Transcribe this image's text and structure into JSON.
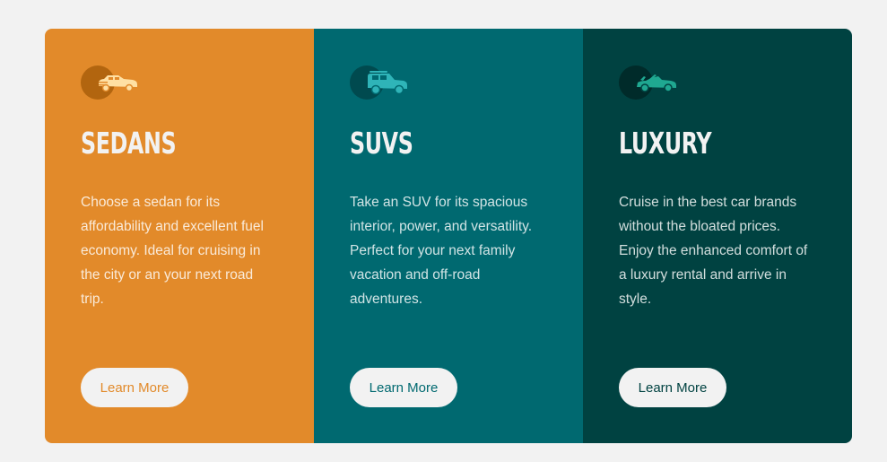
{
  "colors": {
    "sedans": "#e28a2a",
    "suvs": "#006970",
    "luxury": "#004241",
    "button_bg": "#f2f2f2",
    "page_bg": "#f2f2f2"
  },
  "cards": [
    {
      "icon": "sedan-car-icon",
      "title": "Sedans",
      "description": "Choose a sedan for its affordability and excellent fuel economy. Ideal for cruising in the city or an your next road trip.",
      "button_label": "Learn More"
    },
    {
      "icon": "suv-car-icon",
      "title": "SUVs",
      "description": "Take an SUV for its spacious interior, power, and versatility. Perfect for your next family vacation and off-road adventures.",
      "button_label": "Learn More"
    },
    {
      "icon": "luxury-car-icon",
      "title": "Luxury",
      "description": "Cruise in the best car brands without the bloated prices. Enjoy the enhanced comfort of a luxury rental and arrive in style.",
      "button_label": "Learn More"
    }
  ]
}
